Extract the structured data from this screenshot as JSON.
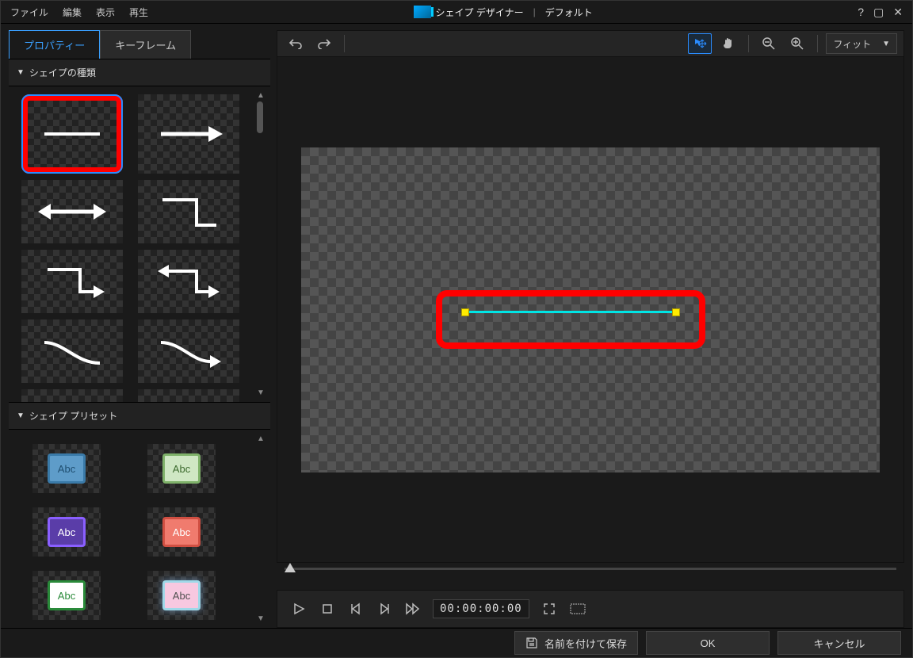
{
  "menu": {
    "file": "ファイル",
    "edit": "編集",
    "view": "表示",
    "play": "再生"
  },
  "title": {
    "app": "シェイプ デザイナー",
    "doc": "デフォルト"
  },
  "tabs": {
    "properties": "プロパティー",
    "keyframes": "キーフレーム"
  },
  "sections": {
    "shapeType": "シェイプの種類",
    "shapePreset": "シェイプ プリセット"
  },
  "presets": [
    {
      "label": "Abc",
      "bg": "#5e9cc9",
      "fg": "#1f4e70",
      "border": "#3a7aa8"
    },
    {
      "label": "Abc",
      "bg": "#cfe7c4",
      "fg": "#3d6b2f",
      "border": "#7fb26a"
    },
    {
      "label": "Abc",
      "bg": "#5a3da8",
      "fg": "#ffffff",
      "border": "#8a5fff"
    },
    {
      "label": "Abc",
      "bg": "#f07b6e",
      "fg": "#ffffff",
      "border": "#d04f42"
    },
    {
      "label": "Abc",
      "bg": "#ffffff",
      "fg": "#2a8a3a",
      "border": "#2a8a3a"
    },
    {
      "label": "Abc",
      "bg": "#f7c8e0",
      "fg": "#505050",
      "border": "#9fd8e8",
      "glow": true
    }
  ],
  "toolbar": {
    "fit": "フィット"
  },
  "timecode": "00:00:00:00",
  "footer": {
    "saveAs": "名前を付けて保存",
    "ok": "OK",
    "cancel": "キャンセル"
  }
}
